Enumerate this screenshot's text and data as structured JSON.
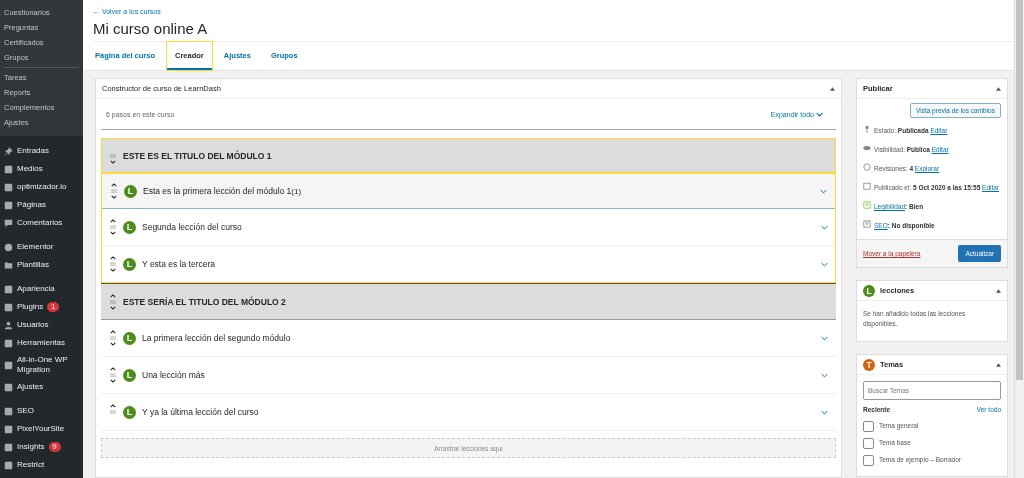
{
  "sidebar": {
    "submenu_groups": [
      [
        "Cuestionarios",
        "Preguntas",
        "Certificados",
        "Grupos"
      ],
      [
        "Tareas",
        "Reports",
        "Complementos",
        "Ajustes"
      ]
    ],
    "menu_groups": [
      [
        {
          "label": "Entradas"
        },
        {
          "label": "Medios"
        },
        {
          "label": "optimizador.io"
        },
        {
          "label": "Páginas"
        },
        {
          "label": "Comentarios"
        }
      ],
      [
        {
          "label": "Elementor"
        },
        {
          "label": "Plantillas"
        }
      ],
      [
        {
          "label": "Apariencia"
        },
        {
          "label": "Plugins",
          "badge": "1"
        },
        {
          "label": "Usuarios"
        },
        {
          "label": "Herramientas"
        },
        {
          "label": "All-in-One WP Migration"
        },
        {
          "label": "Ajustes"
        }
      ],
      [
        {
          "label": "SEO"
        },
        {
          "label": "PixelYourSite"
        },
        {
          "label": "Insights",
          "badge": "9"
        },
        {
          "label": "Restrict"
        }
      ]
    ]
  },
  "header": {
    "back_link": "← Volver a los cursos",
    "title": "Mi curso online A",
    "tabs": [
      {
        "label": "Página del curso",
        "selected": false,
        "highlighted": false
      },
      {
        "label": "Creador",
        "selected": true,
        "highlighted": true
      },
      {
        "label": "Ajustes",
        "selected": false,
        "highlighted": false
      },
      {
        "label": "Grupos",
        "selected": false,
        "highlighted": false
      }
    ]
  },
  "builder": {
    "title": "Constructor de curso de LearnDash",
    "steps": "6 pasos en este curso",
    "expand_all": "Expandir todo",
    "modules": [
      {
        "title": "ESTE ES EL TITULO DEL MÓDULO 1",
        "highlighted": true,
        "lessons_highlighted": true,
        "lessons": [
          {
            "badge": "L",
            "title": "Esta es la primera lección del módulo 1",
            "count": "(1)",
            "selected": true
          },
          {
            "badge": "L",
            "title": "Segunda lección del curso",
            "selected": false
          },
          {
            "badge": "L",
            "title": "Y esta es la tercera",
            "selected": false
          }
        ]
      },
      {
        "title": "ESTE SERÍA EL TITULO DEL MÓDULO 2",
        "highlighted": false,
        "lessons_highlighted": false,
        "lessons": [
          {
            "badge": "L",
            "title": "La primera lección del segundo módulo",
            "selected": false
          },
          {
            "badge": "L",
            "title": "Una lección más",
            "selected": false
          },
          {
            "badge": "L",
            "title": "Y ya la última lección del curso",
            "selected": false
          }
        ]
      }
    ],
    "drop_zone": "Arrastrar lecciones aquí"
  },
  "publish": {
    "title": "Publicar",
    "preview_button": "Vista previa de los cambios",
    "rows": [
      {
        "label": "Estado:",
        "value": "Publicada",
        "link": "Editar"
      },
      {
        "label": "Visibilidad:",
        "value": "Pública",
        "link": "Editar"
      },
      {
        "label": "Revisiones:",
        "value": "4",
        "link": "Explorar"
      },
      {
        "label": "Publicado el:",
        "value": "5 Oct 2020 a las 15:55",
        "link": "Editar"
      },
      {
        "link_first": "Legibilidad",
        "value": ": Bien"
      },
      {
        "link_first": "SEO",
        "value": ": No disponible"
      }
    ],
    "trash_link": "Mover a la papelera",
    "update_button": "Actualizar"
  },
  "lessons_box": {
    "badge": "L",
    "title": "lecciones",
    "message": "Se han añadido todas las lecciones disponibles."
  },
  "topics_box": {
    "badge": "T",
    "title": "Temas",
    "search": {
      "placeholder": "Buscar Temas"
    },
    "recent": "Reciente",
    "view_all": "Ver todo",
    "items": [
      {
        "label": "Tema general",
        "checked": false
      },
      {
        "label": "Tema base",
        "checked": false
      },
      {
        "label": "Tema de ejemplo – Borrador",
        "checked": false
      }
    ]
  }
}
